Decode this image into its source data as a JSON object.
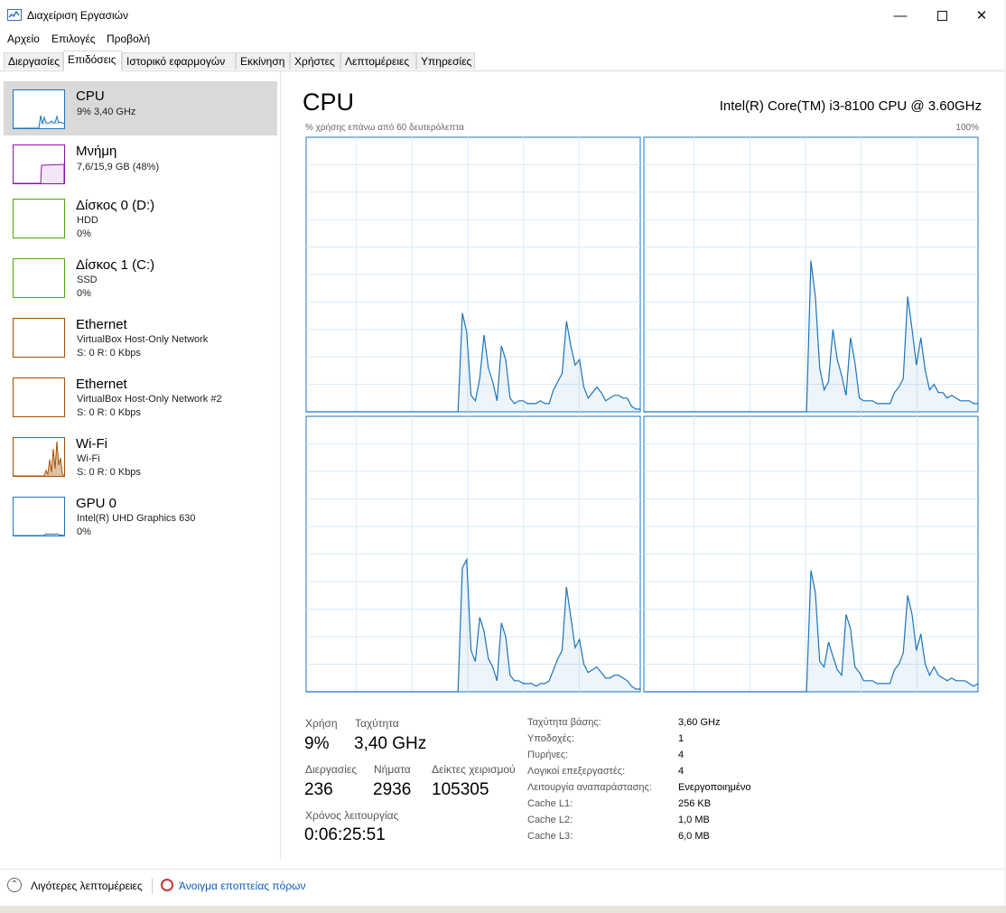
{
  "window": {
    "title": "Διαχείριση Εργασιών"
  },
  "menu": [
    "Αρχείο",
    "Επιλογές",
    "Προβολή"
  ],
  "tabs": [
    "Διεργασίες",
    "Επιδόσεις",
    "Ιστορικό εφαρμογών",
    "Εκκίνηση",
    "Χρήστες",
    "Λεπτομέρειες",
    "Υπηρεσίες"
  ],
  "sidebar": {
    "items": [
      {
        "title": "CPU",
        "line1": "9% 3,40 GHz",
        "line2": "",
        "color": "#1c75bc"
      },
      {
        "title": "Μνήμη",
        "line1": "7,6/15,9 GB (48%)",
        "line2": "",
        "color": "#8b12ae"
      },
      {
        "title": "Δίσκος 0 (D:)",
        "line1": "HDD",
        "line2": "0%",
        "color": "#4da60c"
      },
      {
        "title": "Δίσκος 1 (C:)",
        "line1": "SSD",
        "line2": "0%",
        "color": "#4da60c"
      },
      {
        "title": "Ethernet",
        "line1": "VirtualBox Host-Only Network",
        "line2": "S: 0 R: 0 Kbps",
        "color": "#a74f01"
      },
      {
        "title": "Ethernet",
        "line1": "VirtualBox Host-Only Network #2",
        "line2": "S: 0 R: 0 Kbps",
        "color": "#a74f01"
      },
      {
        "title": "Wi-Fi",
        "line1": "Wi-Fi",
        "line2": "S: 0 R: 0 Kbps",
        "color": "#a74f01"
      },
      {
        "title": "GPU 0",
        "line1": "Intel(R) UHD Graphics 630",
        "line2": "0%",
        "color": "#1c75bc"
      }
    ]
  },
  "main": {
    "title": "CPU",
    "model": "Intel(R) Core(TM) i3-8100 CPU @ 3.60GHz",
    "usage_caption": "% χρήσης επάνω από 60 δευτερόλεπτα",
    "max_pct": "100%"
  },
  "chart_data": {
    "type": "area",
    "y_range": [
      0,
      100
    ],
    "series": [
      {
        "values": [
          0,
          0,
          0,
          0,
          0,
          0,
          0,
          0,
          0,
          0,
          0,
          0,
          0,
          0,
          0,
          0,
          0,
          0,
          0,
          0,
          0,
          0,
          0,
          0,
          0,
          0,
          0,
          0,
          0,
          0,
          0,
          0,
          0,
          0,
          0,
          0,
          36,
          29,
          6,
          4,
          12,
          28,
          16,
          11,
          4,
          24,
          19,
          5,
          3,
          4,
          4,
          3,
          3,
          3,
          4,
          3,
          3,
          8,
          11,
          14,
          33,
          24,
          17,
          19,
          9,
          5,
          7,
          9,
          7,
          4,
          5,
          6,
          6,
          5,
          5,
          2,
          1,
          1
        ]
      },
      {
        "values": [
          0,
          0,
          0,
          0,
          0,
          0,
          0,
          0,
          0,
          0,
          0,
          0,
          0,
          0,
          0,
          0,
          0,
          0,
          0,
          0,
          0,
          0,
          0,
          0,
          0,
          0,
          0,
          0,
          0,
          0,
          0,
          0,
          0,
          0,
          0,
          0,
          0,
          0,
          55,
          42,
          16,
          8,
          11,
          30,
          19,
          13,
          6,
          27,
          18,
          5,
          4,
          4,
          4,
          3,
          3,
          3,
          3,
          7,
          9,
          12,
          42,
          30,
          17,
          27,
          15,
          8,
          10,
          7,
          7,
          5,
          6,
          5,
          4,
          4,
          4,
          3,
          3
        ]
      },
      {
        "values": [
          0,
          0,
          0,
          0,
          0,
          0,
          0,
          0,
          0,
          0,
          0,
          0,
          0,
          0,
          0,
          0,
          0,
          0,
          0,
          0,
          0,
          0,
          0,
          0,
          0,
          0,
          0,
          0,
          0,
          0,
          0,
          0,
          0,
          0,
          0,
          0,
          45,
          48,
          15,
          11,
          27,
          22,
          12,
          9,
          4,
          25,
          20,
          6,
          4,
          4,
          3,
          3,
          3,
          2,
          3,
          3,
          4,
          8,
          12,
          15,
          38,
          27,
          16,
          19,
          10,
          7,
          8,
          9,
          7,
          5,
          5,
          6,
          6,
          5,
          4,
          2,
          1,
          1
        ]
      },
      {
        "values": [
          0,
          0,
          0,
          0,
          0,
          0,
          0,
          0,
          0,
          0,
          0,
          0,
          0,
          0,
          0,
          0,
          0,
          0,
          0,
          0,
          0,
          0,
          0,
          0,
          0,
          0,
          0,
          0,
          0,
          0,
          0,
          0,
          0,
          0,
          0,
          0,
          0,
          0,
          44,
          36,
          11,
          9,
          18,
          13,
          8,
          6,
          28,
          23,
          9,
          7,
          4,
          4,
          4,
          3,
          3,
          3,
          3,
          8,
          10,
          14,
          35,
          28,
          15,
          21,
          10,
          6,
          9,
          6,
          5,
          4,
          5,
          4,
          4,
          4,
          3,
          2,
          3
        ]
      }
    ]
  },
  "stats": {
    "usage_label": "Χρήση",
    "usage_value": "9%",
    "speed_label": "Ταχύτητα",
    "speed_value": "3,40 GHz",
    "processes_label": "Διεργασίες",
    "processes_value": "236",
    "threads_label": "Νήματα",
    "threads_value": "2936",
    "handles_label": "Δείκτες χειρισμού",
    "handles_value": "105305",
    "uptime_label": "Χρόνος λειτουργίας",
    "uptime_value": "0:06:25:51"
  },
  "specs": [
    {
      "label": "Ταχύτητα βάσης:",
      "value": "3,60 GHz"
    },
    {
      "label": "Υποδοχές:",
      "value": "1"
    },
    {
      "label": "Πυρήνες:",
      "value": "4"
    },
    {
      "label": "Λογικοί επεξεργαστές:",
      "value": "4"
    },
    {
      "label": "Λειτουργία αναπαράστασης:",
      "value": "Ενεργοποιημένο"
    },
    {
      "label": "Cache L1:",
      "value": "256 KB"
    },
    {
      "label": "Cache L2:",
      "value": "1,0 MB"
    },
    {
      "label": "Cache L3:",
      "value": "6,0 MB"
    }
  ],
  "footer": {
    "less_details": "Λιγότερες λεπτομέρειες",
    "open_resmon": "Άνοιγμα εποπτείας πόρων"
  }
}
